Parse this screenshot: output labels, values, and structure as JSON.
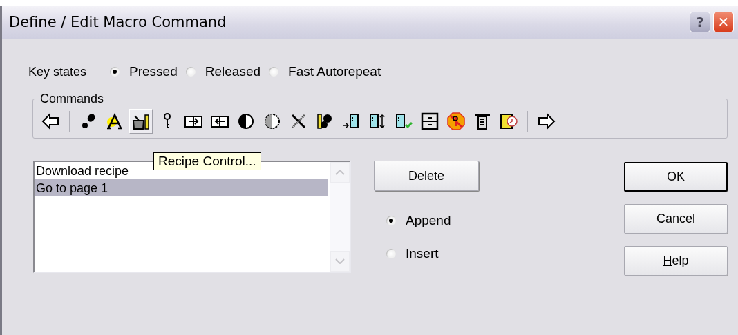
{
  "window": {
    "title": "Define / Edit Macro Command",
    "title_buttons": [
      {
        "kind": "help",
        "label": "?"
      },
      {
        "kind": "close",
        "label": "✕"
      }
    ]
  },
  "key_states": {
    "label": "Key states",
    "options": [
      {
        "label": "Pressed",
        "selected": true
      },
      {
        "label": "Released",
        "selected": false
      },
      {
        "label": "Fast Autorepeat",
        "selected": false
      }
    ]
  },
  "commands": {
    "label": "Commands",
    "toolbar": [
      {
        "kind": "arrow-left",
        "highlighted": false
      },
      {
        "kind": "separator"
      },
      {
        "kind": "footprint",
        "highlighted": false
      },
      {
        "kind": "letter-a",
        "highlighted": false
      },
      {
        "kind": "pot-pencil",
        "highlighted": true
      },
      {
        "kind": "key",
        "highlighted": false
      },
      {
        "kind": "box-right",
        "highlighted": false
      },
      {
        "kind": "box-left",
        "highlighted": false
      },
      {
        "kind": "half-dark",
        "highlighted": false
      },
      {
        "kind": "half-grey",
        "highlighted": false
      },
      {
        "kind": "cross",
        "highlighted": false
      },
      {
        "kind": "pencil-blob",
        "highlighted": false
      },
      {
        "kind": "door-in",
        "highlighted": false
      },
      {
        "kind": "door-updown",
        "highlighted": false
      },
      {
        "kind": "door-check",
        "highlighted": false
      },
      {
        "kind": "cabinet",
        "highlighted": false
      },
      {
        "kind": "no-key",
        "highlighted": false
      },
      {
        "kind": "tower",
        "highlighted": false
      },
      {
        "kind": "clock-card",
        "highlighted": false
      },
      {
        "kind": "separator"
      },
      {
        "kind": "arrow-right",
        "highlighted": false
      }
    ],
    "tooltip": "Recipe Control..."
  },
  "macro_list": {
    "items": [
      {
        "label": "Download recipe",
        "selected": false
      },
      {
        "label": "Go to page 1",
        "selected": true
      }
    ]
  },
  "delete_button": {
    "label": "Delete",
    "underline_first": true
  },
  "position": {
    "options": [
      {
        "label": "Append",
        "selected": true
      },
      {
        "label": "Insert",
        "selected": false
      }
    ]
  },
  "buttons": [
    {
      "label": "OK",
      "default": true
    },
    {
      "label": "Cancel",
      "default": false
    },
    {
      "label": "Help",
      "underline_first": true,
      "default": false
    }
  ]
}
